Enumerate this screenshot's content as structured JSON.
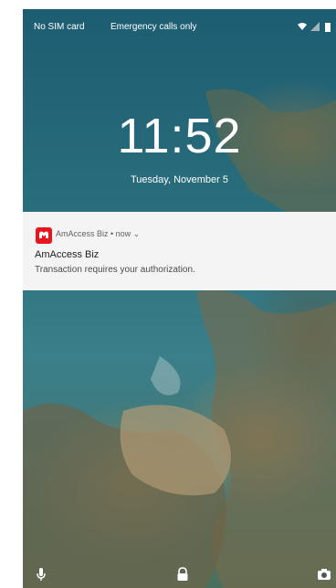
{
  "status_bar": {
    "carrier": "No SIM card",
    "emergency": "Emergency calls only",
    "icons": [
      "wifi-icon",
      "signal-icon",
      "battery-icon"
    ]
  },
  "lockscreen": {
    "time": "11:52",
    "date": "Tuesday, November 5"
  },
  "notification": {
    "app_name": "AmAccess Biz",
    "when": "now",
    "header": "AmAccess Biz • now ⌄",
    "title": "AmAccess Biz",
    "text": "Transaction requires your authorization.",
    "icon_color": "#e8141e"
  },
  "bottom_shortcuts": [
    "microphone-icon",
    "lock-icon",
    "camera-icon"
  ]
}
